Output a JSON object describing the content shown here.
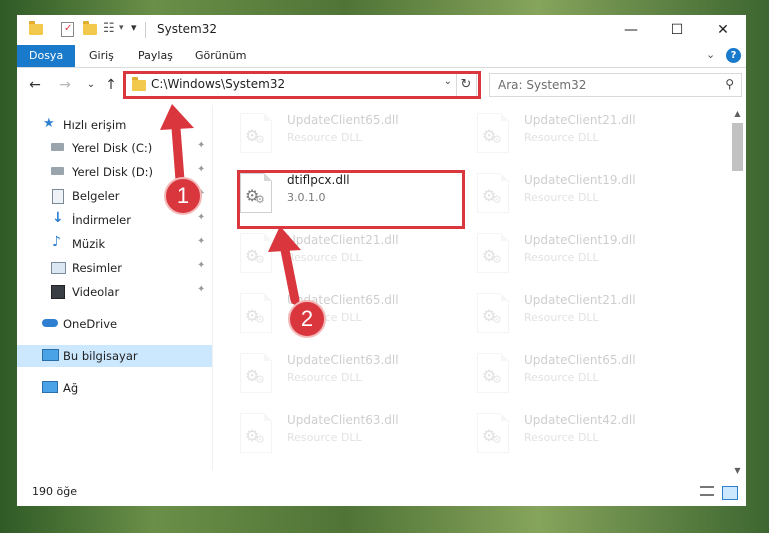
{
  "window": {
    "title": "System32"
  },
  "window_controls": {
    "minimize": "—",
    "maximize": "☐",
    "close": "✕"
  },
  "ribbon": {
    "tabs": [
      {
        "label": "Dosya",
        "active": true
      },
      {
        "label": "Giriş"
      },
      {
        "label": "Paylaş"
      },
      {
        "label": "Görünüm"
      }
    ],
    "expand_glyph": "⌄",
    "help_glyph": "?"
  },
  "nav": {
    "back": "←",
    "forward": "→",
    "recent": "⌄",
    "up": "↑",
    "address": "C:\\Windows\\System32",
    "address_dropdown": "⌄",
    "refresh": "↻",
    "search_placeholder": "Ara: System32",
    "search_glyph": "⚲"
  },
  "sidebar": {
    "items": [
      {
        "label": "Hızlı erişim",
        "icon": "star-icon",
        "pinned": false
      },
      {
        "label": "Yerel Disk (C:)",
        "icon": "drive-icon",
        "pinned": true
      },
      {
        "label": "Yerel Disk (D:)",
        "icon": "drive-icon",
        "pinned": true
      },
      {
        "label": "Belgeler",
        "icon": "documents-icon",
        "pinned": true
      },
      {
        "label": "İndirmeler",
        "icon": "download-icon",
        "pinned": true
      },
      {
        "label": "Müzik",
        "icon": "music-icon",
        "pinned": true
      },
      {
        "label": "Resimler",
        "icon": "pictures-icon",
        "pinned": true
      },
      {
        "label": "Videolar",
        "icon": "video-icon",
        "pinned": true
      },
      {
        "label": "OneDrive",
        "icon": "cloud-icon",
        "pinned": false
      },
      {
        "label": "Bu bilgisayar",
        "icon": "computer-icon",
        "pinned": false,
        "selected": true
      },
      {
        "label": "Ağ",
        "icon": "network-icon",
        "pinned": false
      }
    ],
    "pin_glyph": "📌"
  },
  "files": {
    "left": [
      {
        "name": "UpdateClient65.dll",
        "desc": "Resource DLL",
        "faded": true
      },
      {
        "name": "dtiflpcx.dll",
        "desc": "3.0.1.0",
        "faded": false
      },
      {
        "name": "UpdateClient21.dll",
        "desc": "Resource DLL",
        "faded": true
      },
      {
        "name": "UpdateClient65.dll",
        "desc": "Resource DLL",
        "faded": true
      },
      {
        "name": "UpdateClient63.dll",
        "desc": "Resource DLL",
        "faded": true
      },
      {
        "name": "UpdateClient63.dll",
        "desc": "Resource DLL",
        "faded": true
      }
    ],
    "right": [
      {
        "name": "UpdateClient21.dll",
        "desc": "Resource DLL",
        "faded": true
      },
      {
        "name": "UpdateClient19.dll",
        "desc": "Resource DLL",
        "faded": true
      },
      {
        "name": "UpdateClient19.dll",
        "desc": "Resource DLL",
        "faded": true
      },
      {
        "name": "UpdateClient21.dll",
        "desc": "Resource DLL",
        "faded": true
      },
      {
        "name": "UpdateClient65.dll",
        "desc": "Resource DLL",
        "faded": true
      },
      {
        "name": "UpdateClient42.dll",
        "desc": "Resource DLL",
        "faded": true
      }
    ]
  },
  "scrollbar": {
    "up": "▲",
    "down": "▼"
  },
  "status": {
    "count": "190 öğe"
  },
  "annotations": {
    "step1": "1",
    "step2": "2"
  },
  "colors": {
    "accent": "#1979ca",
    "highlight": "#d9363e",
    "selected_bg": "#cce8ff"
  }
}
